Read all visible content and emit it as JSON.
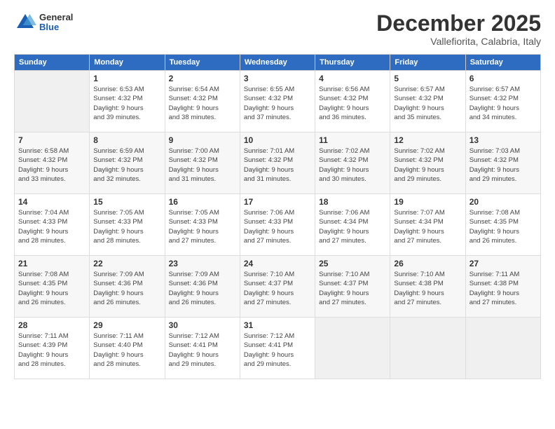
{
  "logo": {
    "general": "General",
    "blue": "Blue"
  },
  "header": {
    "month": "December 2025",
    "location": "Vallefiorita, Calabria, Italy"
  },
  "days_of_week": [
    "Sunday",
    "Monday",
    "Tuesday",
    "Wednesday",
    "Thursday",
    "Friday",
    "Saturday"
  ],
  "weeks": [
    [
      {
        "day": "",
        "info": ""
      },
      {
        "day": "1",
        "info": "Sunrise: 6:53 AM\nSunset: 4:32 PM\nDaylight: 9 hours\nand 39 minutes."
      },
      {
        "day": "2",
        "info": "Sunrise: 6:54 AM\nSunset: 4:32 PM\nDaylight: 9 hours\nand 38 minutes."
      },
      {
        "day": "3",
        "info": "Sunrise: 6:55 AM\nSunset: 4:32 PM\nDaylight: 9 hours\nand 37 minutes."
      },
      {
        "day": "4",
        "info": "Sunrise: 6:56 AM\nSunset: 4:32 PM\nDaylight: 9 hours\nand 36 minutes."
      },
      {
        "day": "5",
        "info": "Sunrise: 6:57 AM\nSunset: 4:32 PM\nDaylight: 9 hours\nand 35 minutes."
      },
      {
        "day": "6",
        "info": "Sunrise: 6:57 AM\nSunset: 4:32 PM\nDaylight: 9 hours\nand 34 minutes."
      }
    ],
    [
      {
        "day": "7",
        "info": "Sunrise: 6:58 AM\nSunset: 4:32 PM\nDaylight: 9 hours\nand 33 minutes."
      },
      {
        "day": "8",
        "info": "Sunrise: 6:59 AM\nSunset: 4:32 PM\nDaylight: 9 hours\nand 32 minutes."
      },
      {
        "day": "9",
        "info": "Sunrise: 7:00 AM\nSunset: 4:32 PM\nDaylight: 9 hours\nand 31 minutes."
      },
      {
        "day": "10",
        "info": "Sunrise: 7:01 AM\nSunset: 4:32 PM\nDaylight: 9 hours\nand 31 minutes."
      },
      {
        "day": "11",
        "info": "Sunrise: 7:02 AM\nSunset: 4:32 PM\nDaylight: 9 hours\nand 30 minutes."
      },
      {
        "day": "12",
        "info": "Sunrise: 7:02 AM\nSunset: 4:32 PM\nDaylight: 9 hours\nand 29 minutes."
      },
      {
        "day": "13",
        "info": "Sunrise: 7:03 AM\nSunset: 4:32 PM\nDaylight: 9 hours\nand 29 minutes."
      }
    ],
    [
      {
        "day": "14",
        "info": "Sunrise: 7:04 AM\nSunset: 4:33 PM\nDaylight: 9 hours\nand 28 minutes."
      },
      {
        "day": "15",
        "info": "Sunrise: 7:05 AM\nSunset: 4:33 PM\nDaylight: 9 hours\nand 28 minutes."
      },
      {
        "day": "16",
        "info": "Sunrise: 7:05 AM\nSunset: 4:33 PM\nDaylight: 9 hours\nand 27 minutes."
      },
      {
        "day": "17",
        "info": "Sunrise: 7:06 AM\nSunset: 4:33 PM\nDaylight: 9 hours\nand 27 minutes."
      },
      {
        "day": "18",
        "info": "Sunrise: 7:06 AM\nSunset: 4:34 PM\nDaylight: 9 hours\nand 27 minutes."
      },
      {
        "day": "19",
        "info": "Sunrise: 7:07 AM\nSunset: 4:34 PM\nDaylight: 9 hours\nand 27 minutes."
      },
      {
        "day": "20",
        "info": "Sunrise: 7:08 AM\nSunset: 4:35 PM\nDaylight: 9 hours\nand 26 minutes."
      }
    ],
    [
      {
        "day": "21",
        "info": "Sunrise: 7:08 AM\nSunset: 4:35 PM\nDaylight: 9 hours\nand 26 minutes."
      },
      {
        "day": "22",
        "info": "Sunrise: 7:09 AM\nSunset: 4:36 PM\nDaylight: 9 hours\nand 26 minutes."
      },
      {
        "day": "23",
        "info": "Sunrise: 7:09 AM\nSunset: 4:36 PM\nDaylight: 9 hours\nand 26 minutes."
      },
      {
        "day": "24",
        "info": "Sunrise: 7:10 AM\nSunset: 4:37 PM\nDaylight: 9 hours\nand 27 minutes."
      },
      {
        "day": "25",
        "info": "Sunrise: 7:10 AM\nSunset: 4:37 PM\nDaylight: 9 hours\nand 27 minutes."
      },
      {
        "day": "26",
        "info": "Sunrise: 7:10 AM\nSunset: 4:38 PM\nDaylight: 9 hours\nand 27 minutes."
      },
      {
        "day": "27",
        "info": "Sunrise: 7:11 AM\nSunset: 4:38 PM\nDaylight: 9 hours\nand 27 minutes."
      }
    ],
    [
      {
        "day": "28",
        "info": "Sunrise: 7:11 AM\nSunset: 4:39 PM\nDaylight: 9 hours\nand 28 minutes."
      },
      {
        "day": "29",
        "info": "Sunrise: 7:11 AM\nSunset: 4:40 PM\nDaylight: 9 hours\nand 28 minutes."
      },
      {
        "day": "30",
        "info": "Sunrise: 7:12 AM\nSunset: 4:41 PM\nDaylight: 9 hours\nand 29 minutes."
      },
      {
        "day": "31",
        "info": "Sunrise: 7:12 AM\nSunset: 4:41 PM\nDaylight: 9 hours\nand 29 minutes."
      },
      {
        "day": "",
        "info": ""
      },
      {
        "day": "",
        "info": ""
      },
      {
        "day": "",
        "info": ""
      }
    ]
  ]
}
